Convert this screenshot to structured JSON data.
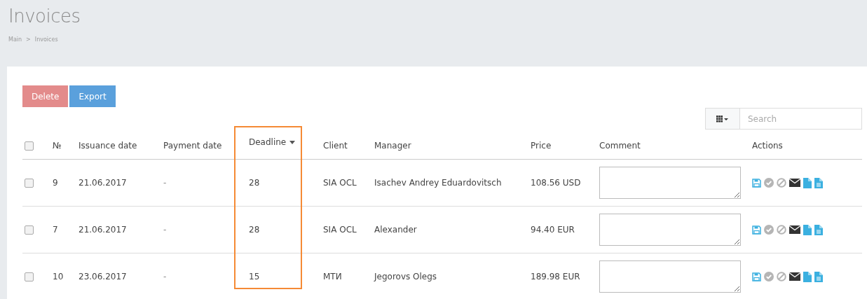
{
  "page": {
    "title": "Invoices"
  },
  "breadcrumb": [
    {
      "label": "Main"
    },
    {
      "label": "Invoices"
    }
  ],
  "separator": ">",
  "toolbar": {
    "buttons": [
      {
        "label": "Delete",
        "kind": "danger"
      },
      {
        "label": "Export",
        "kind": "primary"
      }
    ]
  },
  "search": {
    "placeholder": "Search"
  },
  "table": {
    "select_all": {
      "checked": false
    },
    "columns": [
      {
        "label": "№",
        "sorted": false,
        "highlighted": false
      },
      {
        "label": "Issuance date",
        "sorted": false,
        "highlighted": false
      },
      {
        "label": "Payment date",
        "sorted": false,
        "highlighted": false
      },
      {
        "label": "Deadline",
        "sorted": true,
        "highlighted": true
      },
      {
        "label": "Client",
        "sorted": false,
        "highlighted": false
      },
      {
        "label": "Manager",
        "sorted": false,
        "highlighted": false
      },
      {
        "label": "Price",
        "sorted": false,
        "highlighted": false
      },
      {
        "label": "Comment",
        "sorted": false,
        "highlighted": false
      },
      {
        "label": "Actions",
        "sorted": false,
        "highlighted": false
      }
    ],
    "rows": [
      {
        "checked": false,
        "number": "9",
        "issuance_date": "21.06.2017",
        "payment_date": "-",
        "deadline": "28",
        "client": "SIA OCL",
        "manager": "Isachev Andrey Eduardovitsch",
        "price": "108.56 USD"
      },
      {
        "checked": false,
        "number": "7",
        "issuance_date": "21.06.2017",
        "payment_date": "-",
        "deadline": "28",
        "client": "SIA OCL",
        "manager": "Alexander",
        "price": "94.40 EUR"
      },
      {
        "checked": false,
        "number": "10",
        "issuance_date": "23.06.2017",
        "payment_date": "-",
        "deadline": "15",
        "client": "МТИ",
        "manager": "Jegorovs Olegs",
        "price": "189.98 EUR"
      }
    ]
  }
}
